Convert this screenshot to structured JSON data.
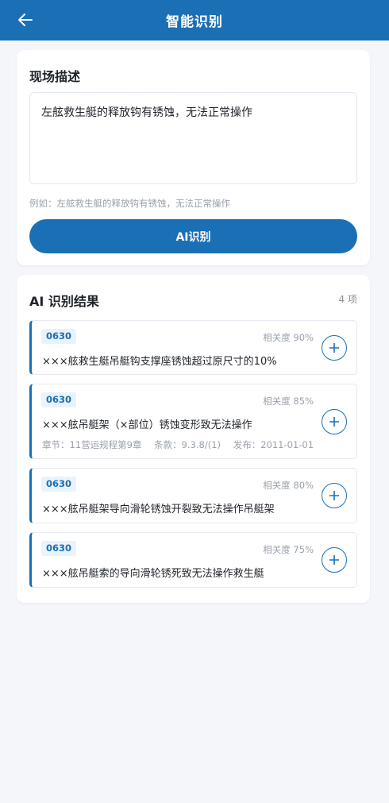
{
  "header": {
    "back_icon": "arrow-left-icon",
    "title": "智能识别",
    "accent_color": "#1a6fb5"
  },
  "description": {
    "section_title": "现场描述",
    "input_value": "左舷救生艇的释放钩有锈蚀，无法正常操作",
    "hint": "例如：左舷救生艇的释放钩有锈蚀，无法正常操作",
    "ai_button_label": "AI识别"
  },
  "results": {
    "section_title": "AI 识别结果",
    "count": "4 项",
    "items": [
      {
        "code": "0630",
        "relevance": "相关度 90%",
        "text": "×××舷救生艇吊艇钩支撑座锈蚀超过原尺寸的10%"
      },
      {
        "code": "0630",
        "relevance": "相关度 85%",
        "text": "×××舷吊艇架（×部位）锈蚀变形致无法操作",
        "chapter": "章节：11营运规程第9章",
        "clause": "条款：9.3.8/(1)",
        "published": "发布：2011-01-01"
      },
      {
        "code": "0630",
        "relevance": "相关度 80%",
        "text": "×××舷吊艇架导向滑轮锈蚀开裂致无法操作吊艇架"
      },
      {
        "code": "0630",
        "relevance": "相关度 75%",
        "text": "×××舷吊艇索的导向滑轮锈死致无法操作救生艇"
      }
    ],
    "add_icon": "plus-circle-icon"
  }
}
